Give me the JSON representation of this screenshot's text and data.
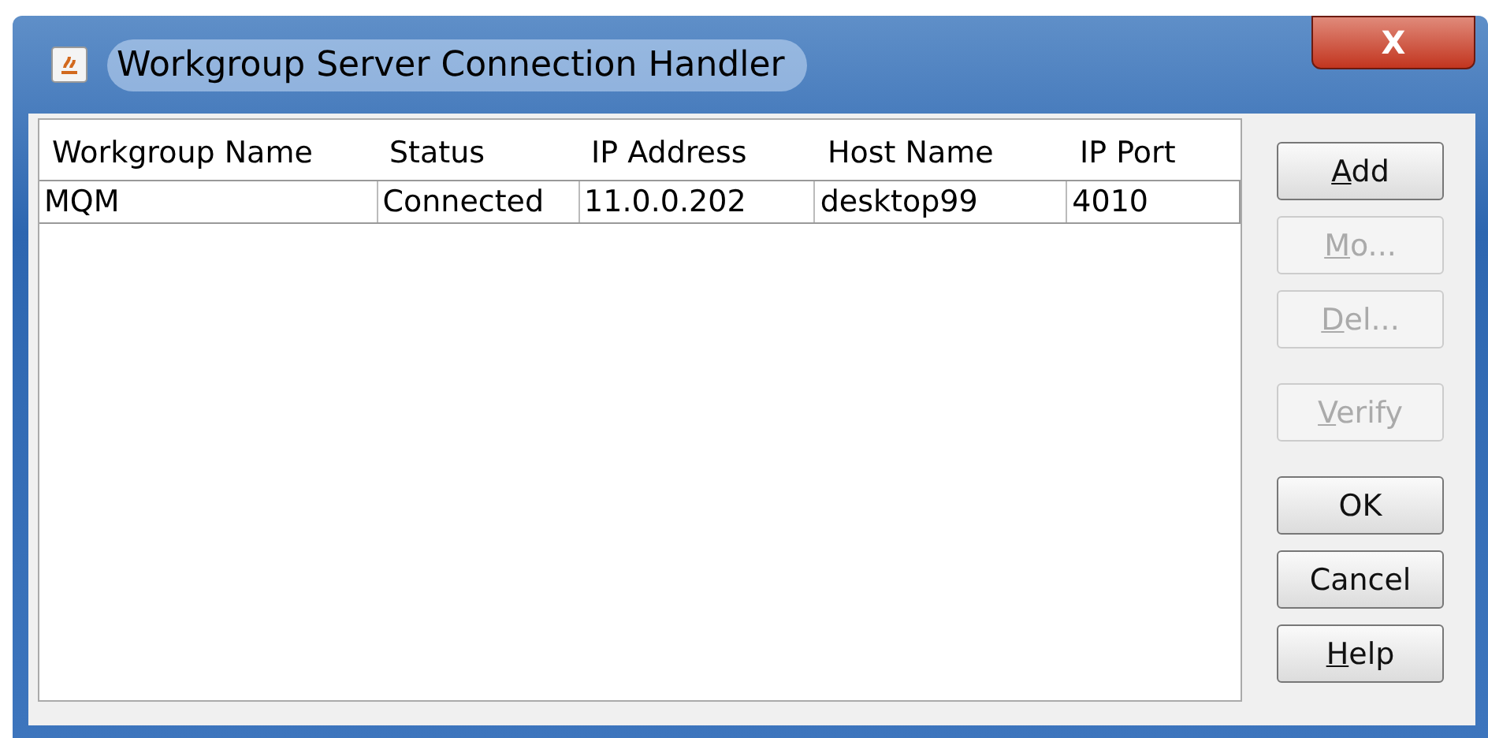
{
  "window": {
    "title": "Workgroup Server Connection Handler",
    "close": "X"
  },
  "table": {
    "columns": [
      "Workgroup Name",
      "Status",
      "IP Address",
      "Host Name",
      "IP Port"
    ],
    "rows": [
      {
        "selected": false,
        "cells": [
          "MQM",
          "Connected",
          "11.0.0.202",
          "desktop99",
          "4010"
        ]
      }
    ]
  },
  "button_groups": [
    [
      {
        "label": "Add",
        "disabled": false,
        "mnemonic": true
      },
      {
        "label": "Mo...",
        "disabled": true,
        "mnemonic": true
      },
      {
        "label": "Del...",
        "disabled": true,
        "mnemonic": true
      }
    ],
    [
      {
        "label": "Verify",
        "disabled": true,
        "mnemonic": true
      }
    ],
    [
      {
        "label": "OK",
        "disabled": false,
        "mnemonic": false
      },
      {
        "label": "Cancel",
        "disabled": false,
        "mnemonic": false
      },
      {
        "label": "Help",
        "disabled": false,
        "mnemonic": true
      }
    ]
  ]
}
